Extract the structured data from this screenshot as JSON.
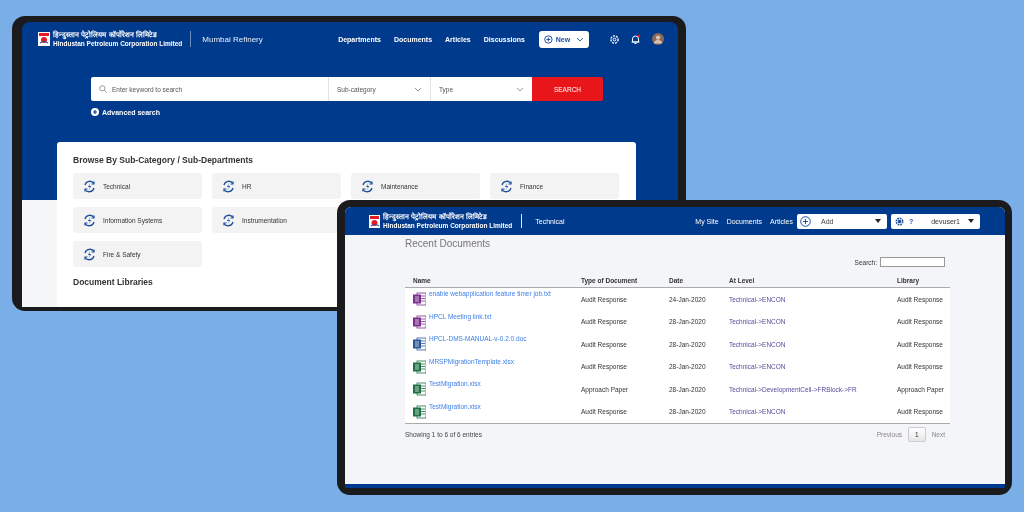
{
  "left_window": {
    "logo": {
      "hindi": "हिन्दुस्तान पेट्रोलियम कॉर्पोरेशन लिमिटेड",
      "english": "Hindustan Petroleum Corporation Limited"
    },
    "site": "Mumbai Refinery",
    "nav": [
      "Departments",
      "Documents",
      "Articles",
      "Discussions"
    ],
    "new_button": "New",
    "search": {
      "placeholder": "Enter keyword to search",
      "subcategory": "Sub-category",
      "type": "Type",
      "button": "SEARCH"
    },
    "advanced_search": "Advanced search",
    "browse": {
      "title": "Browse By Sub-Category / Sub-Departments",
      "tile_rows": [
        [
          "Technical",
          "HR",
          "Maintenance",
          "Finance"
        ],
        [
          "Information Systems",
          "Instrumentation"
        ],
        [
          "Fire & Safety"
        ]
      ]
    },
    "libraries_title": "Document Libraries"
  },
  "right_window": {
    "logo": {
      "hindi": "हिन्दुस्तान पेट्रोलियम कॉर्पोरेशन लिमिटेड",
      "english": "Hindustan Petroleum Corporation Limited"
    },
    "site": "Technical",
    "nav": [
      "My Site",
      "Documents",
      "Articles"
    ],
    "add_menu": "Add",
    "help": "?",
    "user": "devuser1",
    "title": "Recent Documents",
    "search_label": "Search:",
    "table": {
      "columns": [
        "Name",
        "Type of Document",
        "Date",
        "At Level",
        "Library"
      ],
      "rows": [
        {
          "kind": "onenote",
          "name": "enable webapplication feature timer job.txt",
          "type": "Audit Response",
          "date": "24-Jan-2020",
          "at_level": "Technical->ENCON",
          "library": "Audit Response"
        },
        {
          "kind": "onenote",
          "name": "HPCL Meeting link.txt",
          "type": "Audit Response",
          "date": "28-Jan-2020",
          "at_level": "Technical->ENCON",
          "library": "Audit Response"
        },
        {
          "kind": "word",
          "name": "HPCL-DMS-MANUAL-v-0.2.0.doc",
          "type": "Audit Response",
          "date": "28-Jan-2020",
          "at_level": "Technical->ENCON",
          "library": "Audit Response"
        },
        {
          "kind": "excel",
          "name": "MRSPMigrationTemplate.xlsx",
          "type": "Audit Response",
          "date": "28-Jan-2020",
          "at_level": "Technical->ENCON",
          "library": "Audit Response"
        },
        {
          "kind": "excel",
          "name": "TestMigration.xlsx",
          "type": "Approach Paper",
          "date": "28-Jan-2020",
          "at_level": "Technical->DevelopmentCell->FRBlock->FR",
          "library": "Approach Paper"
        },
        {
          "kind": "excel",
          "name": "TestMigration.xlsx",
          "type": "Audit Response",
          "date": "28-Jan-2020",
          "at_level": "Technical->ENCON",
          "library": "Audit Response"
        }
      ]
    },
    "footer": "Showing 1 to 6 of 6 entries",
    "pagination": {
      "previous": "Previous",
      "pages": [
        {
          "label": "1",
          "selected": true
        }
      ],
      "next": "Next"
    }
  }
}
